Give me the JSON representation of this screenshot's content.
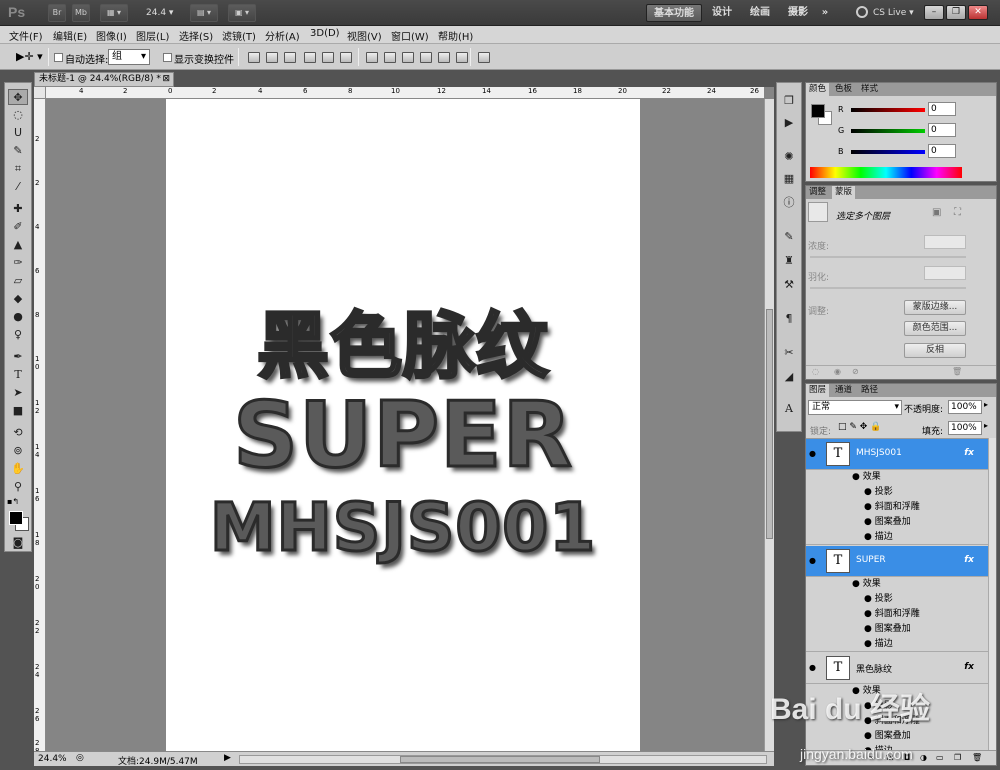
{
  "app": {
    "logo": "Ps",
    "zoom_select": "24.4",
    "cs_live": "CS Live"
  },
  "workspaces": [
    "基本功能",
    "设计",
    "绘画",
    "摄影",
    "»"
  ],
  "menu": [
    "文件(F)",
    "编辑(E)",
    "图像(I)",
    "图层(L)",
    "选择(S)",
    "滤镜(T)",
    "分析(A)",
    "3D(D)",
    "视图(V)",
    "窗口(W)",
    "帮助(H)"
  ],
  "options": {
    "auto_select_label": "自动选择:",
    "auto_select_value": "组",
    "show_transform_label": "显示变换控件"
  },
  "document": {
    "tab_title": "未标题-1 @ 24.4%(RGB/8) *",
    "zoom": "24.4%",
    "doc_info": "文档:24.9M/5.47M"
  },
  "canvas_text": {
    "line1": "黑色脉纹",
    "line2": "SUPER",
    "line3": "MHSJS001"
  },
  "hruler_ticks": [
    "4",
    "2",
    "0",
    "2",
    "4",
    "6",
    "8",
    "10",
    "12",
    "14",
    "16",
    "18",
    "20",
    "22",
    "24",
    "26"
  ],
  "vruler_ticks": [
    "2",
    "2",
    "4",
    "6",
    "8",
    "1 0",
    "1 2",
    "1 4",
    "1 6",
    "1 8",
    "2 0",
    "2 2",
    "2 4",
    "2 6",
    "2 8"
  ],
  "color_panel": {
    "tabs": [
      "颜色",
      "色板",
      "样式"
    ],
    "r": "R",
    "g": "G",
    "b": "B",
    "r_value": "0",
    "g_value": "0",
    "b_value": "0"
  },
  "adjust_panel": {
    "tabs": [
      "调整",
      "蒙版"
    ],
    "hint": "选定多个图层",
    "density": "浓度:",
    "feather": "羽化:",
    "refine": "调整:",
    "btn_edge": "蒙版边缘...",
    "btn_range": "颜色范围...",
    "btn_invert": "反相"
  },
  "layers_panel": {
    "tabs": [
      "图层",
      "通道",
      "路径"
    ],
    "blend_mode": "正常",
    "opacity_label": "不透明度:",
    "opacity_value": "100%",
    "lock_label": "锁定:",
    "fill_label": "填充:",
    "fill_value": "100%",
    "layers": [
      {
        "name": "MHSJS001",
        "fx": "fx",
        "effects": [
          "效果",
          "投影",
          "斜面和浮雕",
          "图案叠加",
          "描边"
        ]
      },
      {
        "name": "SUPER",
        "fx": "fx",
        "effects": [
          "效果",
          "投影",
          "斜面和浮雕",
          "图案叠加",
          "描边"
        ]
      },
      {
        "name": "黑色脉纹",
        "fx": "fx",
        "effects": [
          "效果",
          "投影",
          "斜面和浮雕",
          "图案叠加",
          "描边"
        ]
      }
    ],
    "thumb_glyph": "T"
  },
  "watermark": {
    "brand": "Bai du 经验",
    "url": "jingyan.baidu.com"
  }
}
